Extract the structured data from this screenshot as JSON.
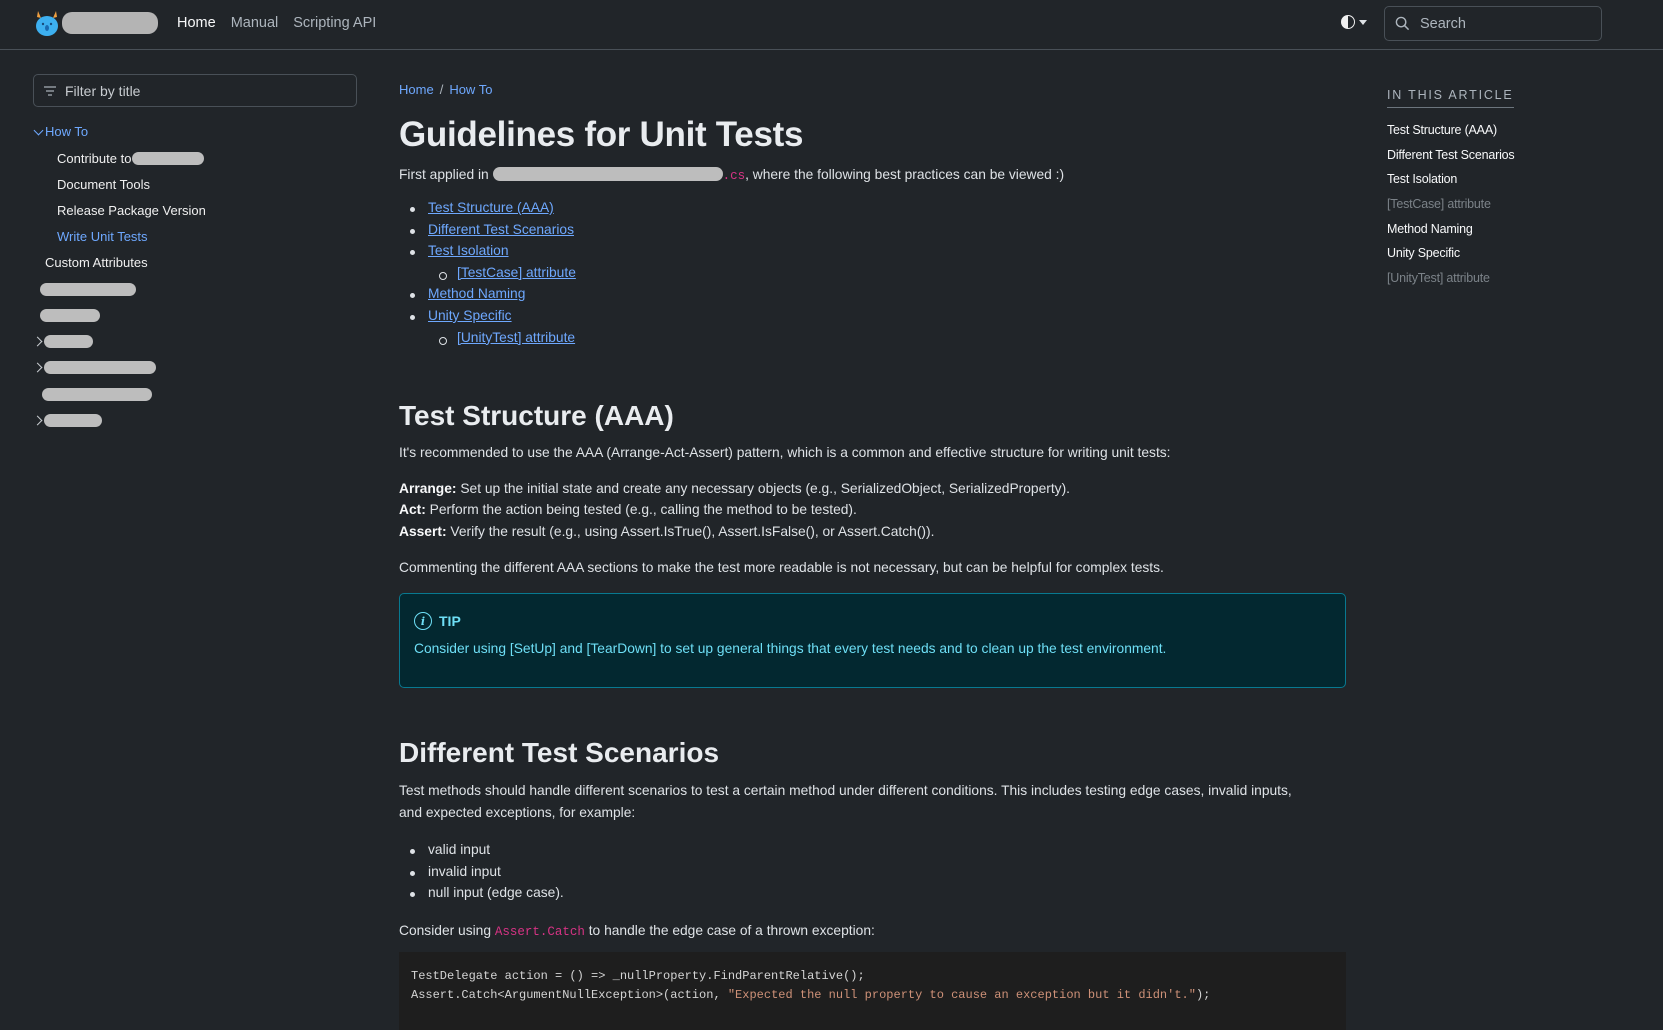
{
  "header": {
    "nav": [
      {
        "label": "Home",
        "active": true
      },
      {
        "label": "Manual",
        "active": false
      },
      {
        "label": "Scripting API",
        "active": false
      }
    ],
    "theme_toggle_icon": "contrast-icon",
    "search_placeholder": "Search"
  },
  "sidebar": {
    "filter_placeholder": "Filter by title",
    "items": [
      {
        "label": "How To",
        "expanded": true,
        "active": true
      },
      {
        "label": "Contribute to",
        "redacted_suffix": true
      },
      {
        "label": "Document Tools"
      },
      {
        "label": "Release Package Version"
      },
      {
        "label": "Write Unit Tests",
        "active": true
      },
      {
        "label": "Custom Attributes"
      }
    ]
  },
  "breadcrumb": [
    {
      "label": "Home"
    },
    {
      "label": "How To"
    }
  ],
  "article": {
    "title": "Guidelines for Unit Tests",
    "intro_prefix": "First applied in ",
    "intro_ext": ".cs",
    "intro_suffix": ", where the following best practices can be viewed :)",
    "toc_links": [
      {
        "label": "Test Structure (AAA)",
        "level": 1
      },
      {
        "label": "Different Test Scenarios",
        "level": 1
      },
      {
        "label": "Test Isolation",
        "level": 1
      },
      {
        "label": "[TestCase] attribute",
        "level": 2
      },
      {
        "label": "Method Naming",
        "level": 1
      },
      {
        "label": "Unity Specific",
        "level": 1
      },
      {
        "label": "[UnityTest] attribute",
        "level": 2
      }
    ],
    "section1": {
      "heading": "Test Structure (AAA)",
      "intro": "It's recommended to use the AAA (Arrange-Act-Assert) pattern, which is a common and effective structure for writing unit tests:",
      "arrange_label": "Arrange:",
      "arrange_text": " Set up the initial state and create any necessary objects (e.g., SerializedObject, SerializedProperty).",
      "act_label": "Act:",
      "act_text": " Perform the action being tested (e.g., calling the method to be tested).",
      "assert_label": "Assert:",
      "assert_text": " Verify the result (e.g., using Assert.IsTrue(), Assert.IsFalse(), or Assert.Catch()).",
      "note": "Commenting the different AAA sections to make the test more readable is not necessary, but can be helpful for complex tests.",
      "tip": {
        "title": "TIP",
        "body": "Consider using [SetUp] and [TearDown] to set up general things that every test needs and to clean up the test environment."
      }
    },
    "section2": {
      "heading": "Different Test Scenarios",
      "intro_line1": "Test methods should handle different scenarios to test a certain method under different conditions. This includes testing edge cases, invalid inputs,",
      "intro_line2": "and expected exceptions, for example:",
      "examples": [
        "valid input",
        "invalid input",
        "null input (edge case)."
      ],
      "consider_prefix": "Consider using ",
      "consider_code": "Assert.Catch",
      "consider_suffix": " to handle the edge case of a thrown exception:",
      "code_line1": "TestDelegate action = () => _nullProperty.FindParentRelative();",
      "code_line2_prefix": "Assert.Catch<ArgumentNullException>(action, ",
      "code_line2_string": "\"Expected the null property to cause an exception but it didn't.\"",
      "code_line2_suffix": ");"
    }
  },
  "in_this_article": {
    "heading": "IN THIS ARTICLE",
    "items": [
      {
        "label": "Test Structure (AAA)",
        "level": 1
      },
      {
        "label": "Different Test Scenarios",
        "level": 1
      },
      {
        "label": "Test Isolation",
        "level": 1
      },
      {
        "label": "[TestCase] attribute",
        "level": 2
      },
      {
        "label": "Method Naming",
        "level": 1
      },
      {
        "label": "Unity Specific",
        "level": 1
      },
      {
        "label": "[UnityTest] attribute",
        "level": 2
      }
    ]
  },
  "colors": {
    "background": "#212529",
    "link": "#6ea8fe",
    "tip_bg": "#032830",
    "tip_border": "#087990",
    "tip_text": "#6edff6",
    "inline_code": "#d63384",
    "code_bg": "#1e1e1e",
    "code_string": "#ce9178"
  }
}
